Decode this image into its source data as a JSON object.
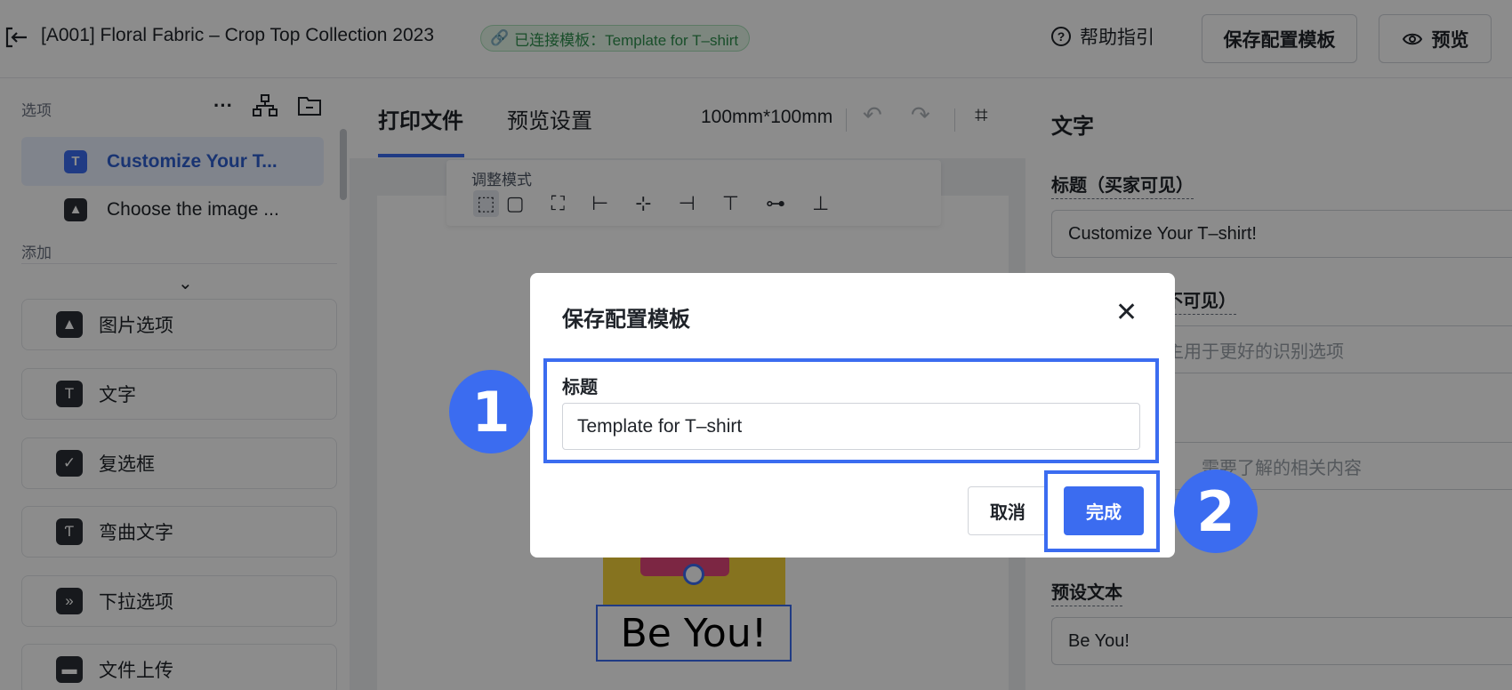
{
  "header": {
    "title": "[A001] Floral Fabric – Crop Top Collection 2023",
    "connected_template": "已连接模板：Template for T–shirt",
    "help": "帮助指引",
    "save_template": "保存配置模板",
    "preview": "预览"
  },
  "sidebar": {
    "options_label": "选项",
    "options": [
      {
        "label": "Customize Your T...",
        "icon": "text-icon",
        "active": true
      },
      {
        "label": "Choose the image ...",
        "icon": "image-icon",
        "active": false
      }
    ],
    "add_label": "添加",
    "add_items": [
      {
        "label": "图片选项",
        "icon": "image-icon"
      },
      {
        "label": "文字",
        "icon": "text-icon"
      },
      {
        "label": "复选框",
        "icon": "checkbox-icon"
      },
      {
        "label": "弯曲文字",
        "icon": "curved-text-icon"
      },
      {
        "label": "下拉选项",
        "icon": "dropdown-icon"
      },
      {
        "label": "文件上传",
        "icon": "folder-icon"
      }
    ]
  },
  "center": {
    "tabs": [
      "打印文件",
      "预览设置"
    ],
    "dimension": "100mm*100mm",
    "adjust_mode": "调整模式",
    "canvas_text": "Be You!"
  },
  "right_panel": {
    "title": "文字",
    "title_label": "标题（买家可见）",
    "title_value": "Customize Your T–shirt!",
    "label2_partial": "不可见）",
    "placeholder2_partial": "主用于更好的识别选项",
    "placeholder3_partial": "需要了解的相关内容",
    "preset_label": "预设文本",
    "preset_value": "Be You!"
  },
  "dialog": {
    "title": "保存配置模板",
    "field_label": "标题",
    "field_value": "Template for T–shirt",
    "cancel": "取消",
    "done": "完成"
  },
  "steps": [
    "1",
    "2"
  ],
  "colors": {
    "accent": "#3b6cf0",
    "chip_green": "#2f8f4e"
  }
}
